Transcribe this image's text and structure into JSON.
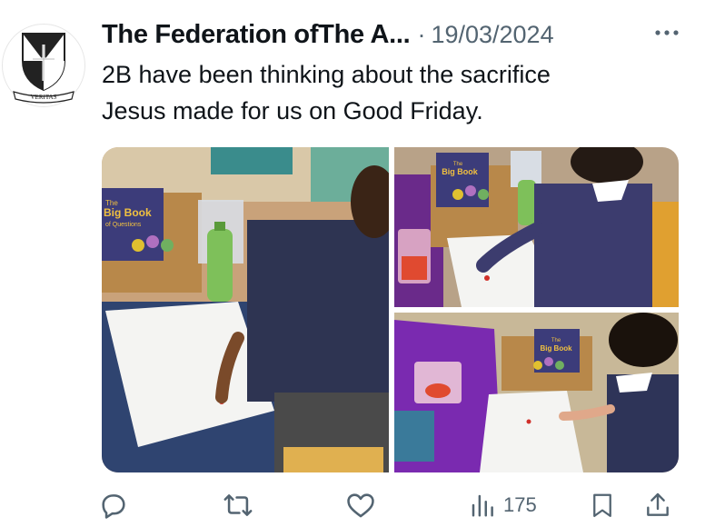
{
  "tweet": {
    "author_name": "The Federation ofThe A...",
    "separator": "·",
    "date": "19/03/2024",
    "text_line1": "2B have been thinking about the sacrifice",
    "text_line2": "Jesus made for us on Good Friday.",
    "avatar_motto": "VERITAS"
  },
  "media": {
    "book_title_line1": "The",
    "book_title_line2": "Big Book",
    "book_title_line3": "of Questions"
  },
  "actions": {
    "reply_icon": "reply-icon",
    "retweet_icon": "retweet-icon",
    "like_icon": "heart-icon",
    "views_icon": "views-icon",
    "views_count": "175",
    "bookmark_icon": "bookmark-icon",
    "share_icon": "share-icon"
  },
  "colors": {
    "text_primary": "#0f1419",
    "text_secondary": "#536471",
    "icon": "#536471"
  }
}
